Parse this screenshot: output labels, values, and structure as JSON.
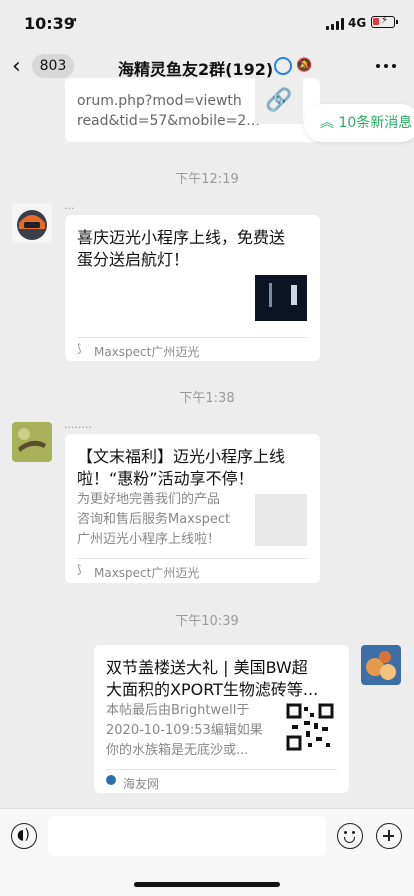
{
  "status": {
    "time": "10:39",
    "network": "4G"
  },
  "nav": {
    "unread": "803",
    "title": "海精灵鱼友2群(192)"
  },
  "new_messages": "10条新消息",
  "messages": [
    {
      "partial_title_lines": [
        "orum.php?mod=viewth",
        "read&tid=57&mobile=2..."
      ]
    },
    {
      "timestamp": "下午12:19",
      "nickname": "...",
      "title_lines": [
        "喜庆迈光小程序上线，免费送",
        "蛋分送启航灯！"
      ],
      "source": "Maxspect广州迈光"
    },
    {
      "timestamp": "下午1:38",
      "nickname": "........",
      "title_lines": [
        "【文末福利】迈光小程序上线",
        "啦！“惠粉”活动享不停！"
      ],
      "desc_lines": [
        "为更好地完善我们的产品",
        "咨询和售后服务Maxspect",
        "广州迈光小程序上线啦！"
      ],
      "source": "Maxspect广州迈光"
    },
    {
      "timestamp": "下午10:39",
      "title_lines": [
        "双节盖楼送大礼 | 美国BW超",
        "大面积的XPORT生物滤砖等..."
      ],
      "desc_lines": [
        "本帖最后由Brightwell于",
        "2020-10-109:53编辑如果",
        "你的水族箱是无底沙或..."
      ],
      "source": "海友网"
    }
  ],
  "colors": {
    "accent": "#2aae67",
    "bg": "#ededed"
  }
}
